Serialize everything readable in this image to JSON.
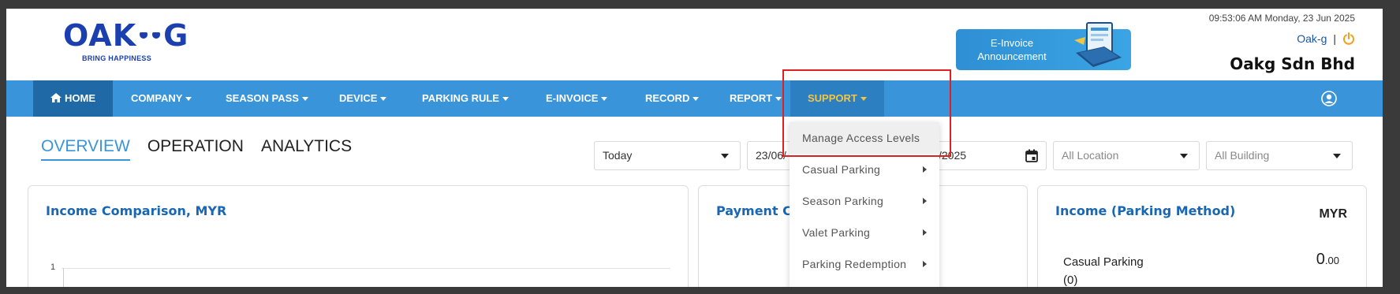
{
  "header": {
    "logo_text": "OAK G",
    "logo_tagline": "BRING HAPPINESS",
    "einvoice_banner": [
      "E-Invoice",
      "Announcement"
    ],
    "datetime": "09:53:06 AM Monday, 23 Jun 2025",
    "username": "Oak-g",
    "separator": "|",
    "company_name": "Oakg Sdn Bhd"
  },
  "nav": {
    "items": [
      {
        "label": "HOME",
        "icon": "home-icon"
      },
      {
        "label": "COMPANY"
      },
      {
        "label": "SEASON PASS"
      },
      {
        "label": "DEVICE"
      },
      {
        "label": "PARKING RULE"
      },
      {
        "label": "E-INVOICE"
      },
      {
        "label": "RECORD"
      },
      {
        "label": "REPORT"
      },
      {
        "label": "SUPPORT"
      }
    ],
    "active": "HOME",
    "open": "SUPPORT"
  },
  "tabs": [
    {
      "label": "OVERVIEW",
      "active": true
    },
    {
      "label": "OPERATION",
      "active": false
    },
    {
      "label": "ANALYTICS",
      "active": false
    }
  ],
  "filters": {
    "period": "Today",
    "date_start_visible": "23/06/",
    "date_end_visible": "/2025",
    "location": "All Location",
    "building": "All Building"
  },
  "cards": {
    "income_comparison": {
      "title": "Income Comparison, MYR",
      "axis_tick": "1"
    },
    "payment": {
      "title_visible": "Payment Cha"
    },
    "parking_method": {
      "title": "Income (Parking Method)",
      "currency": "MYR",
      "row_label": "Casual Parking",
      "row_count": "(0)",
      "row_value_int": "0",
      "row_value_dec": ".00"
    }
  },
  "support_menu": {
    "items": [
      {
        "label": "Manage Access Levels",
        "submenu": false
      },
      {
        "label": "Casual Parking",
        "submenu": true
      },
      {
        "label": "Season Parking",
        "submenu": true
      },
      {
        "label": "Valet Parking",
        "submenu": true
      },
      {
        "label": "Parking Redemption",
        "submenu": true
      }
    ]
  },
  "colors": {
    "nav_bg": "#3a94d9",
    "nav_active": "#1f6aa6",
    "support_text": "#f5c542",
    "title_blue": "#1a66b3",
    "highlight": "#e02020"
  }
}
